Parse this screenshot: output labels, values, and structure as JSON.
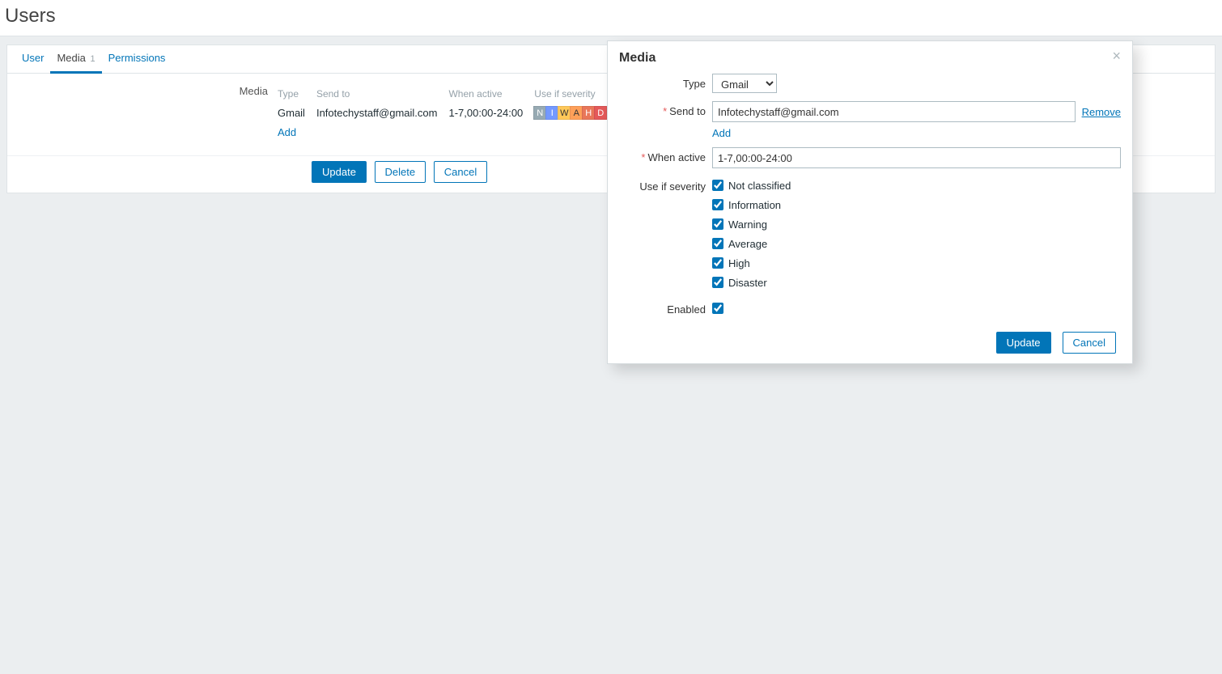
{
  "page": {
    "title": "Users"
  },
  "tabs": {
    "user": "User",
    "media": "Media",
    "media_count": "1",
    "permissions": "Permissions"
  },
  "media_section": {
    "label": "Media",
    "headers": {
      "type": "Type",
      "send_to": "Send to",
      "when_active": "When active",
      "use_if_severity": "Use if severity"
    },
    "row": {
      "type": "Gmail",
      "send_to": "Infotechystaff@gmail.com",
      "when_active": "1-7,00:00-24:00"
    },
    "severity_chips": [
      "N",
      "I",
      "W",
      "A",
      "H",
      "D"
    ],
    "add": "Add"
  },
  "buttons": {
    "update": "Update",
    "delete": "Delete",
    "cancel": "Cancel"
  },
  "modal": {
    "title": "Media",
    "labels": {
      "type": "Type",
      "send_to": "Send to",
      "when_active": "When active",
      "use_if_severity": "Use if severity",
      "enabled": "Enabled"
    },
    "type_value": "Gmail",
    "send_to_value": "Infotechystaff@gmail.com",
    "remove": "Remove",
    "add": "Add",
    "when_active_value": "1-7,00:00-24:00",
    "severities": {
      "not_classified": "Not classified",
      "information": "Information",
      "warning": "Warning",
      "average": "Average",
      "high": "High",
      "disaster": "Disaster"
    },
    "update": "Update",
    "cancel": "Cancel"
  }
}
